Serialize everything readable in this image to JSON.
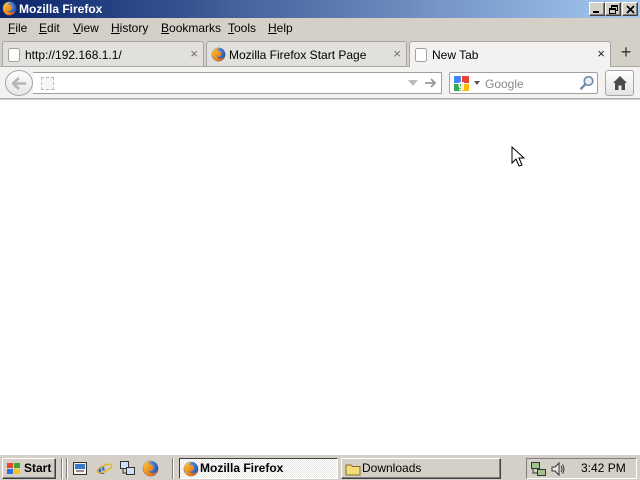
{
  "window": {
    "title": "Mozilla Firefox",
    "controls": [
      "minimize",
      "restore",
      "close"
    ]
  },
  "menubar": {
    "items": [
      {
        "label": "File",
        "accesskey": "F"
      },
      {
        "label": "Edit",
        "accesskey": "E"
      },
      {
        "label": "View",
        "accesskey": "V"
      },
      {
        "label": "History",
        "accesskey": "H"
      },
      {
        "label": "Bookmarks",
        "accesskey": "B"
      },
      {
        "label": "Tools",
        "accesskey": "T"
      },
      {
        "label": "Help",
        "accesskey": "H"
      }
    ]
  },
  "tabs": [
    {
      "label": "http://192.168.1.1/",
      "icon": "blank-page-icon",
      "active": false
    },
    {
      "label": "Mozilla Firefox Start Page",
      "icon": "firefox-icon",
      "active": false
    },
    {
      "label": "New Tab",
      "icon": "blank-page-icon",
      "active": true
    }
  ],
  "navbar": {
    "url_value": "",
    "search_engine": "Google",
    "search_placeholder": "Google"
  },
  "taskbar": {
    "start_label": "Start",
    "quick_launch": [
      "show-desktop-icon",
      "internet-explorer-icon",
      "network-icon",
      "firefox-icon"
    ],
    "buttons": [
      {
        "label": "Mozilla Firefox",
        "icon": "firefox-icon",
        "active": true
      },
      {
        "label": "Downloads",
        "icon": "folder-icon",
        "active": false
      }
    ],
    "tray_icons": [
      "network-tray-icon",
      "volume-icon"
    ],
    "clock": "3:42 PM"
  },
  "colors": {
    "titlebar_start": "#0a246a",
    "titlebar_end": "#a6caf0",
    "system_face": "#d4d0c8"
  }
}
